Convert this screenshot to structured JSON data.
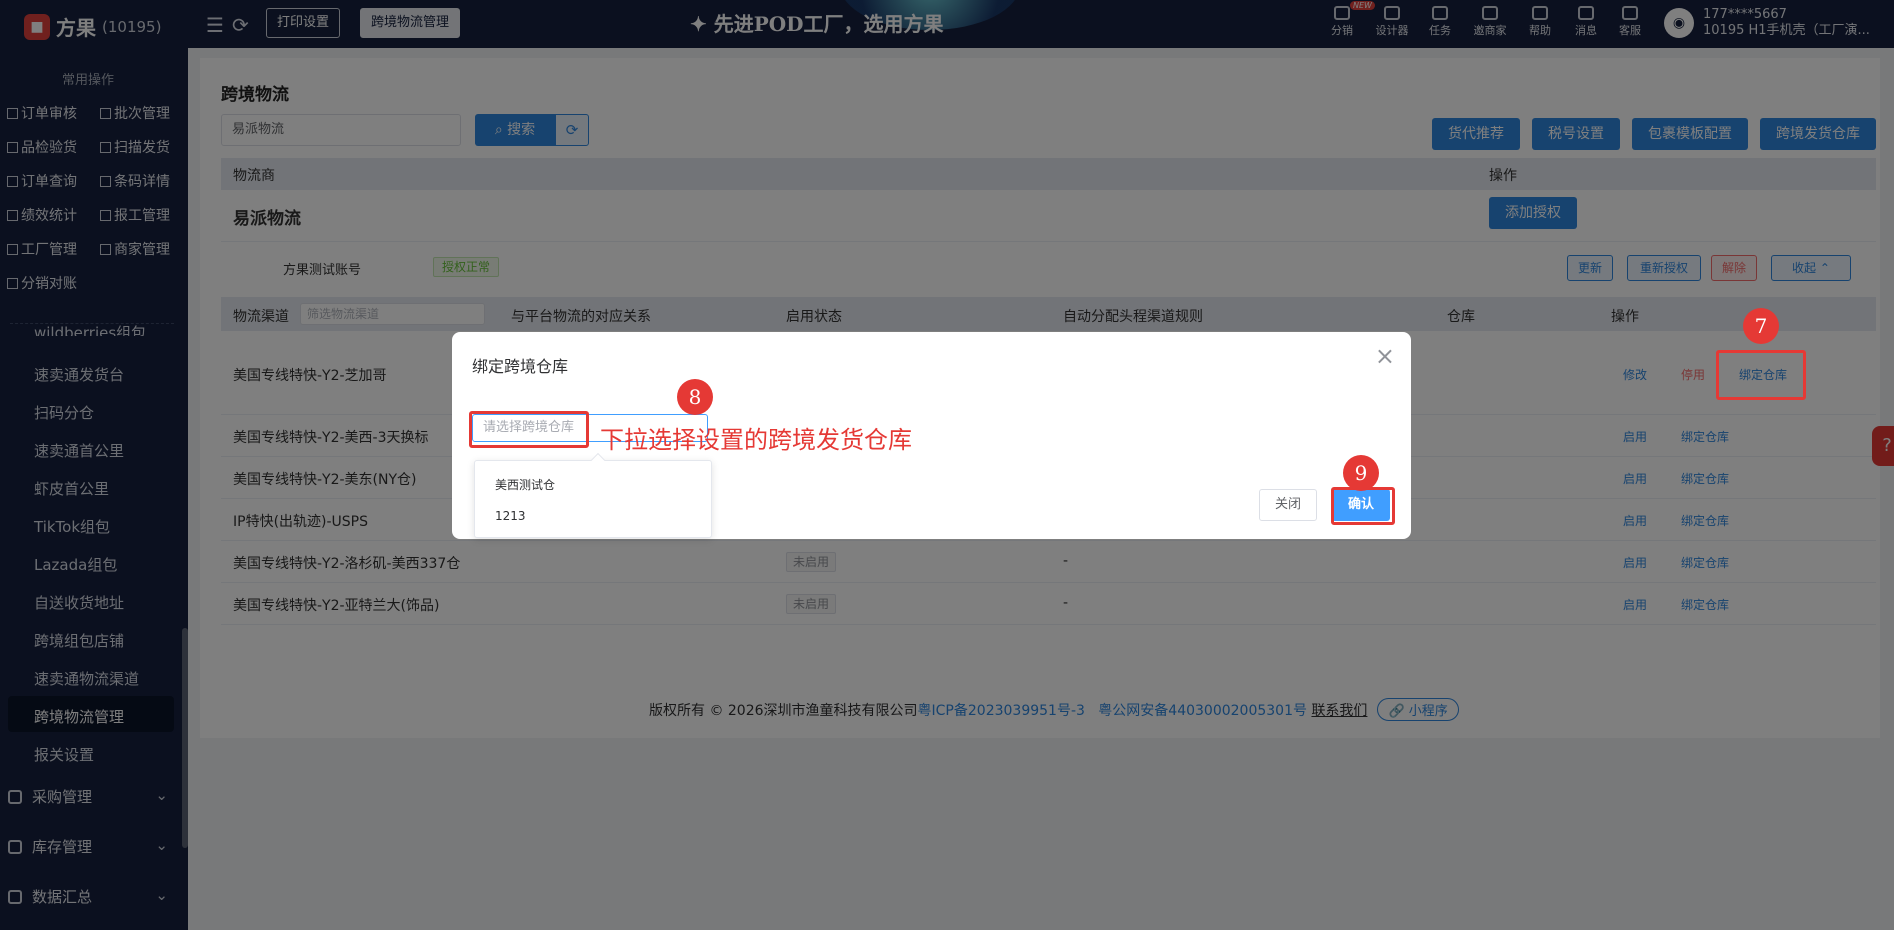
{
  "header": {
    "brand": "方果",
    "brand_id": "(10195)",
    "tabs": [
      "打印设置",
      "跨境物流管理"
    ],
    "slogan": "✦ 先进POD工厂，选用方果",
    "new_badge": "NEW",
    "nav": [
      {
        "label": "分销",
        "icon": "distribution-icon"
      },
      {
        "label": "设计器",
        "icon": "image-icon"
      },
      {
        "label": "任务",
        "icon": "task-icon"
      },
      {
        "label": "邀商家",
        "icon": "invite-icon"
      },
      {
        "label": "帮助",
        "icon": "help-icon"
      },
      {
        "label": "消息",
        "icon": "message-icon"
      },
      {
        "label": "客服",
        "icon": "support-icon"
      }
    ],
    "user_phone": "177****5667",
    "user_name": "10195 H1手机壳（工厂演..."
  },
  "sidebar": {
    "section": "常用操作",
    "quick": [
      {
        "label": "订单审核"
      },
      {
        "label": "批次管理"
      },
      {
        "label": "品检验货"
      },
      {
        "label": "扫描发货"
      },
      {
        "label": "订单查询"
      },
      {
        "label": "条码详情"
      },
      {
        "label": "绩效统计"
      },
      {
        "label": "报工管理"
      },
      {
        "label": "工厂管理"
      },
      {
        "label": "商家管理"
      },
      {
        "label": "分销对账"
      }
    ],
    "items": [
      "wildberries组包",
      "速卖通发货台",
      "扫码分仓",
      "速卖通首公里",
      "虾皮首公里",
      "TikTok组包",
      "Lazada组包",
      "自送收货地址",
      "跨境组包店铺",
      "速卖通物流渠道",
      "跨境物流管理",
      "报关设置"
    ],
    "groups": [
      "采购管理",
      "库存管理",
      "数据汇总"
    ]
  },
  "page": {
    "title": "跨境物流",
    "search_value": "易派物流",
    "search_btn": "搜索",
    "actions": [
      "货代推荐",
      "税号设置",
      "包裹模板配置",
      "跨境发货仓库"
    ],
    "provider_header": "物流商",
    "op_header": "操作",
    "provider": "易派物流",
    "add_auth": "添加授权",
    "account": "方果测试账号",
    "auth_status": "授权正常",
    "acct_btns": [
      "更新",
      "重新授权",
      "解除",
      "收起"
    ],
    "channel_cols": [
      "物流渠道",
      "与平台物流的对应关系",
      "启用状态",
      "自动分配头程渠道规则",
      "仓库",
      "操作"
    ],
    "channel_filter": "筛选物流渠道",
    "rows": [
      {
        "name": "美国专线特快-Y2-芝加哥",
        "status": "",
        "rule": "",
        "ops": [
          "修改",
          "停用",
          "绑定仓库"
        ]
      },
      {
        "name": "美国专线特快-Y2-美西-3天换标",
        "status": "",
        "rule": "",
        "ops": [
          "启用",
          "绑定仓库"
        ]
      },
      {
        "name": "美国专线特快-Y2-美东(NY仓)",
        "status": "",
        "rule": "",
        "ops": [
          "启用",
          "绑定仓库"
        ]
      },
      {
        "name": "IP特快(出轨迹)-USPS",
        "status": "",
        "rule": "",
        "ops": [
          "启用",
          "绑定仓库"
        ]
      },
      {
        "name": "美国专线特快-Y2-洛杉矶-美西337仓",
        "status": "未启用",
        "rule": "-",
        "ops": [
          "启用",
          "绑定仓库"
        ]
      },
      {
        "name": "美国专线特快-Y2-亚特兰大(饰品)",
        "status": "未启用",
        "rule": "-",
        "ops": [
          "启用",
          "绑定仓库"
        ]
      }
    ]
  },
  "footer": {
    "text": "版权所有 © 2026深圳市渔童科技有限公司",
    "icp": "粤ICP备2023039951号-3",
    "police": "粤公网安备44030002005301号",
    "contact": "联系我们",
    "mini": "🔗 小程序"
  },
  "modal": {
    "title": "绑定跨境仓库",
    "placeholder": "请选择跨境仓库",
    "options": [
      "美西测试仓",
      "1213"
    ],
    "close": "关闭",
    "confirm": "确认"
  },
  "annotations": {
    "n7": "7",
    "n8": "8",
    "n9": "9",
    "hint": "下拉选择设置的跨境发货仓库"
  },
  "colors": {
    "nav_bg": "#16213e",
    "primary": "#2e86de",
    "annotation": "#e53935"
  }
}
